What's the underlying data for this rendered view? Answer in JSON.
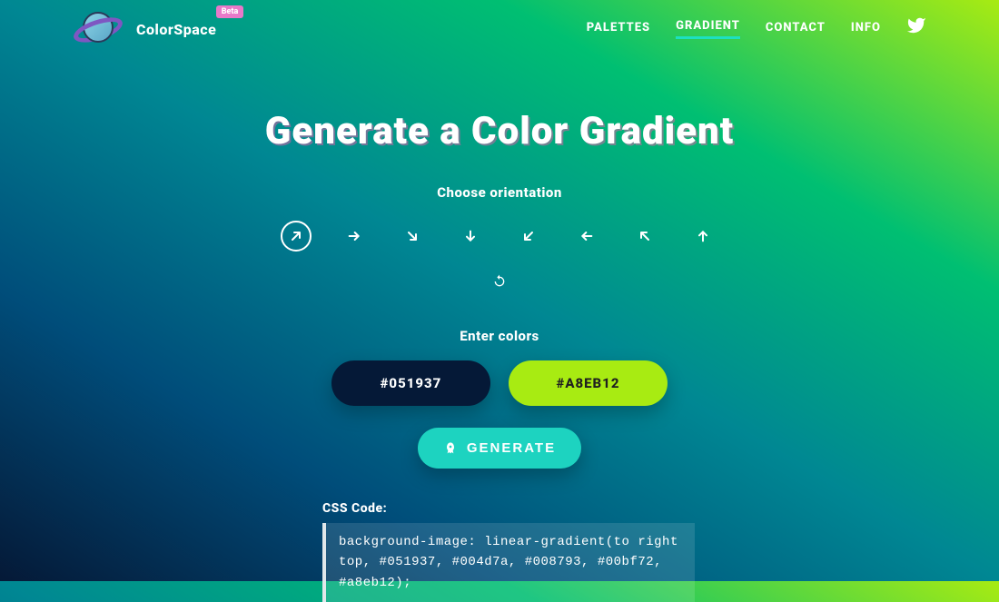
{
  "brand": {
    "name": "ColorSpace",
    "badge": "Beta"
  },
  "nav": {
    "items": [
      {
        "label": "PALETTES"
      },
      {
        "label": "GRADIENT",
        "active": true
      },
      {
        "label": "CONTACT"
      },
      {
        "label": "INFO"
      }
    ]
  },
  "heading": "Generate a Color Gradient",
  "orientation": {
    "label": "Choose orientation",
    "selected": 0,
    "options": [
      "top-right",
      "right",
      "bottom-right",
      "bottom",
      "bottom-left",
      "left",
      "top-left",
      "top"
    ]
  },
  "colors": {
    "label": "Enter colors",
    "color1": "#051937",
    "color2": "#A8EB12"
  },
  "generate": {
    "label": "GENERATE"
  },
  "css": {
    "label": "CSS Code:",
    "code": "background-image: linear-gradient(to right top, #051937, #004d7a, #008793, #00bf72, #a8eb12);"
  }
}
